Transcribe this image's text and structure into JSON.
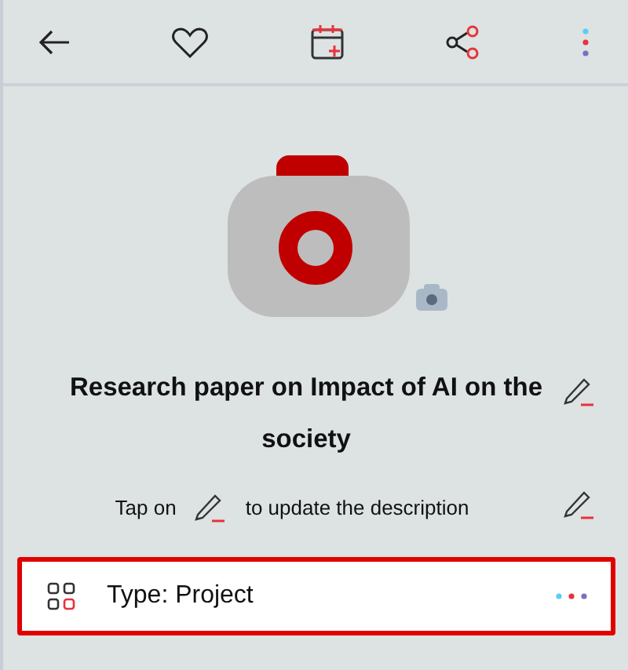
{
  "title": "Research paper on Impact of AI on the society",
  "description_hint": {
    "before": "Tap on",
    "after": "to update the description"
  },
  "type_row": {
    "label": "Type: Project",
    "highlighted": true
  }
}
